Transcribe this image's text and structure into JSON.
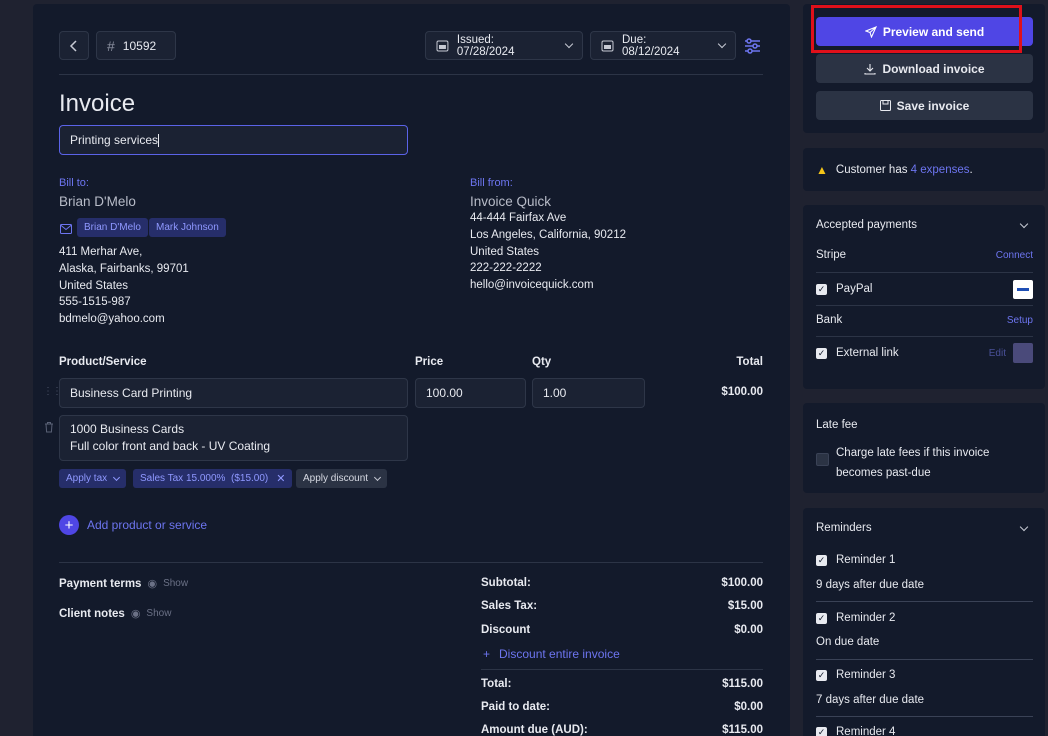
{
  "header": {
    "invoice_number": "10592",
    "hash_symbol": "#",
    "issued": "Issued: 07/28/2024",
    "due": "Due: 08/12/2024"
  },
  "invoice": {
    "title": "Invoice",
    "description_value": "Printing services"
  },
  "bill_to": {
    "label": "Bill to:",
    "name": "Brian D'Melo",
    "contacts": [
      "Brian D'Melo",
      "Mark Johnson"
    ],
    "address": [
      "411 Merhar Ave,",
      "Alaska, Fairbanks, 99701",
      "United States",
      "555-1515-987",
      "bdmelo@yahoo.com"
    ]
  },
  "bill_from": {
    "label": "Bill from:",
    "name": "Invoice Quick",
    "address": [
      "44-444 Fairfax Ave",
      "Los Angeles, California, 90212",
      "United States",
      "222-222-2222",
      "hello@invoicequick.com"
    ]
  },
  "items_table": {
    "headers": {
      "product": "Product/Service",
      "price": "Price",
      "qty": "Qty",
      "total": "Total"
    },
    "item": {
      "name": "Business Card Printing",
      "price": "100.00",
      "qty": "1.00",
      "total": "$100.00",
      "description_line1": "1000 Business Cards",
      "description_line2": "Full color front and back - UV Coating"
    },
    "apply_tax": "Apply tax",
    "sales_tax_chip": "Sales Tax 15.000%  ($15.00)",
    "apply_discount": "Apply discount",
    "add_product": "Add product or service"
  },
  "notes": {
    "payment_terms": "Payment terms",
    "client_notes": "Client notes",
    "show": "Show"
  },
  "totals": {
    "subtotal_label": "Subtotal:",
    "subtotal": "$100.00",
    "tax_label": "Sales Tax:",
    "tax": "$15.00",
    "discount_label": "Discount",
    "discount": "$0.00",
    "discount_entire": "Discount entire invoice",
    "total_label": "Total:",
    "total": "$115.00",
    "paid_label": "Paid to date:",
    "paid": "$0.00",
    "due_label": "Amount due (AUD):",
    "due": "$115.00"
  },
  "actions": {
    "preview_send": "Preview and send",
    "download": "Download invoice",
    "save": "Save invoice"
  },
  "notice": {
    "prefix": "Customer has ",
    "link": "4 expenses",
    "suffix": "."
  },
  "payments": {
    "title": "Accepted payments",
    "stripe": "Stripe",
    "stripe_action": "Connect",
    "paypal": "PayPal",
    "bank": "Bank",
    "bank_action": "Setup",
    "external": "External link",
    "external_action": "Edit"
  },
  "late_fee": {
    "title": "Late fee",
    "line1": "Charge late fees if this invoice",
    "line2": "becomes past-due"
  },
  "reminders": {
    "title": "Reminders",
    "items": [
      {
        "name": "Reminder 1",
        "desc": "9 days after due date"
      },
      {
        "name": "Reminder 2",
        "desc": "On due date"
      },
      {
        "name": "Reminder 3",
        "desc": "7 days after due date"
      },
      {
        "name": "Reminder 4"
      }
    ]
  },
  "colors": {
    "accent": "#4f46e5",
    "link": "#6d75f0",
    "highlight": "#e0101a",
    "background": "#131a2b"
  }
}
